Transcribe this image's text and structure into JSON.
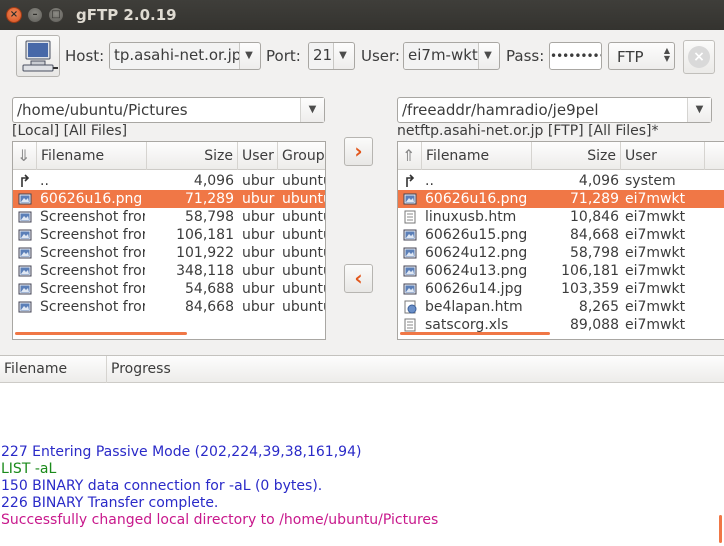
{
  "window": {
    "title": "gFTP 2.0.19"
  },
  "toolbar": {
    "host_label": "Host:",
    "host_value": "tp.asahi-net.or.jp",
    "port_label": "Port:",
    "port_value": "21",
    "user_label": "User:",
    "user_value": "ei7m-wkt",
    "pass_label": "Pass:",
    "pass_value": "••••••••••",
    "protocol_value": "FTP",
    "connect_icon": "computer-network-icon",
    "stop_icon": "stop-icon"
  },
  "local": {
    "path": "/home/ubuntu/Pictures",
    "status": "[Local] [All Files]",
    "columns": [
      "Filename",
      "Size",
      "User",
      "Group"
    ],
    "rows": [
      {
        "icon": "parent-dir-icon",
        "name": "..",
        "size": "4,096",
        "user": "ubur",
        "group": "ubuntu"
      },
      {
        "icon": "image-file-icon",
        "name": "60626u16.png",
        "size": "71,289",
        "user": "ubur",
        "group": "ubuntu",
        "selected": true
      },
      {
        "icon": "image-file-icon",
        "name": "Screenshot fror",
        "size": "58,798",
        "user": "ubur",
        "group": "ubuntu"
      },
      {
        "icon": "image-file-icon",
        "name": "Screenshot fror",
        "size": "106,181",
        "user": "ubur",
        "group": "ubuntu"
      },
      {
        "icon": "image-file-icon",
        "name": "Screenshot fror",
        "size": "101,922",
        "user": "ubur",
        "group": "ubuntu"
      },
      {
        "icon": "image-file-icon",
        "name": "Screenshot fror",
        "size": "348,118",
        "user": "ubur",
        "group": "ubuntu"
      },
      {
        "icon": "image-file-icon",
        "name": "Screenshot fror",
        "size": "54,688",
        "user": "ubur",
        "group": "ubuntu"
      },
      {
        "icon": "image-file-icon",
        "name": "Screenshot fror",
        "size": "84,668",
        "user": "ubur",
        "group": "ubuntu"
      }
    ]
  },
  "remote": {
    "path": "/freeaddr/hamradio/je9pel",
    "status": "netftp.asahi-net.or.jp [FTP] [All Files]*",
    "columns": [
      "Filename",
      "Size",
      "User"
    ],
    "rows": [
      {
        "icon": "parent-dir-icon",
        "name": "..",
        "size": "4,096",
        "user": "system"
      },
      {
        "icon": "image-file-icon",
        "name": "60626u16.png",
        "size": "71,289",
        "user": "ei7mwkt",
        "selected": true
      },
      {
        "icon": "text-file-icon",
        "name": "linuxusb.htm",
        "size": "10,846",
        "user": "ei7mwkt"
      },
      {
        "icon": "image-file-icon",
        "name": "60626u15.png",
        "size": "84,668",
        "user": "ei7mwkt"
      },
      {
        "icon": "image-file-icon",
        "name": "60624u12.png",
        "size": "58,798",
        "user": "ei7mwkt"
      },
      {
        "icon": "image-file-icon",
        "name": "60624u13.png",
        "size": "106,181",
        "user": "ei7mwkt"
      },
      {
        "icon": "image-file-icon",
        "name": "60626u14.jpg",
        "size": "103,359",
        "user": "ei7mwkt"
      },
      {
        "icon": "html-file-icon",
        "name": "be4lapan.htm",
        "size": "8,265",
        "user": "ei7mwkt"
      },
      {
        "icon": "spreadsheet-file-icon",
        "name": "satscorg.xls",
        "size": "89,088",
        "user": "ei7mwkt"
      }
    ]
  },
  "transfer_buttons": {
    "upload": "›",
    "download": "‹"
  },
  "transfers": {
    "columns": [
      "Filename",
      "Progress"
    ]
  },
  "log": {
    "lines": [
      {
        "text": "227 Entering Passive Mode (202,224,39,38,161,94)",
        "color": "#2a2ac8"
      },
      {
        "text": "LIST -aL",
        "color": "#1a8a1a"
      },
      {
        "text": "150 BINARY data connection for -aL (0 bytes).",
        "color": "#2a2ac8"
      },
      {
        "text": "226 BINARY Transfer complete.",
        "color": "#2a2ac8"
      },
      {
        "text": "Successfully changed local directory to /home/ubuntu/Pictures",
        "color": "#c8188c"
      }
    ]
  },
  "colors": {
    "accent": "#f07746",
    "titlebar": "#3c3b37"
  }
}
